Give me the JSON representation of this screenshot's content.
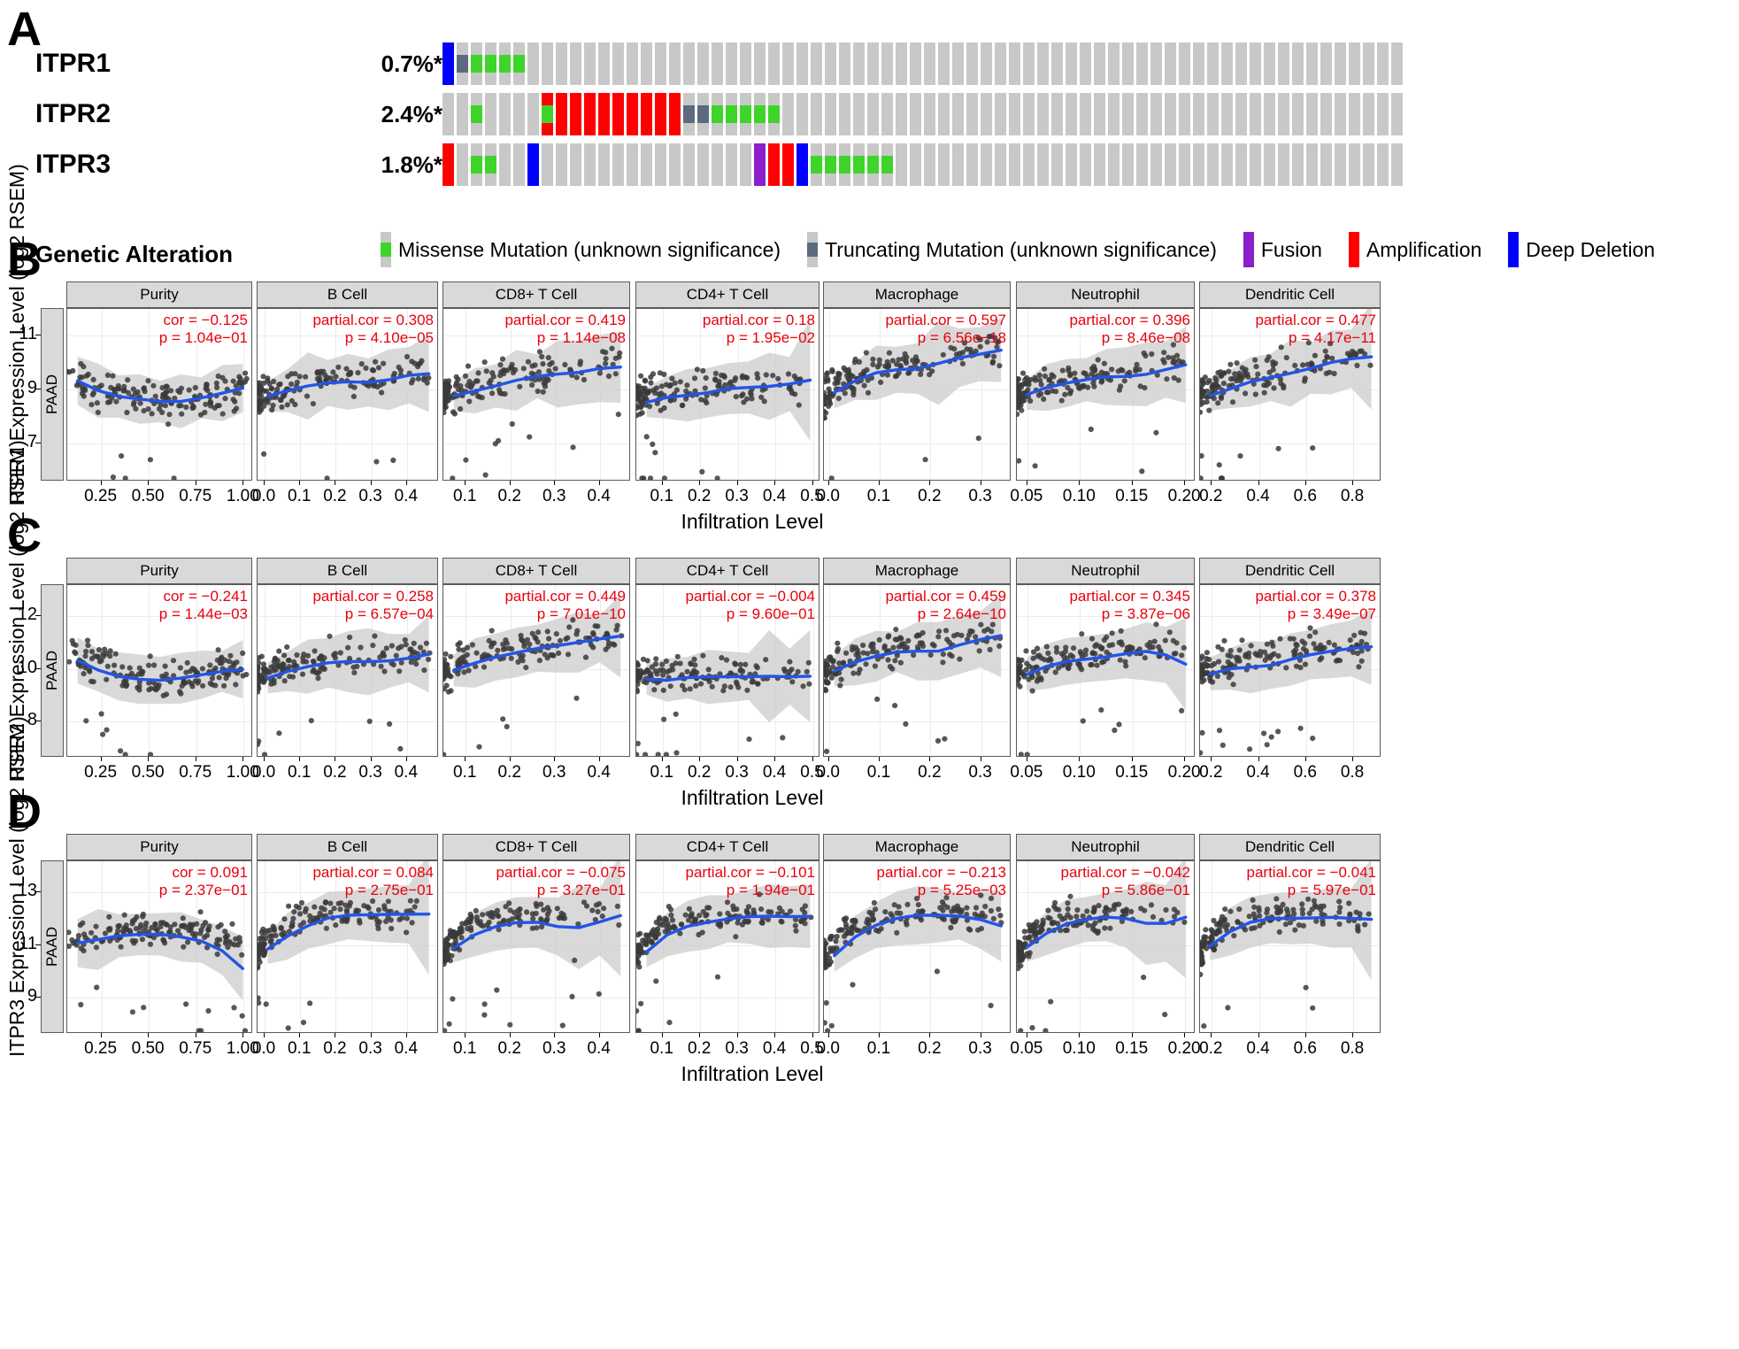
{
  "panels": {
    "a_letter": "A",
    "b_letter": "B",
    "c_letter": "C",
    "d_letter": "D"
  },
  "oncoprint": {
    "rows": [
      {
        "gene": "ITPR1",
        "percent": "0.7%*"
      },
      {
        "gene": "ITPR2",
        "percent": "2.4%*"
      },
      {
        "gene": "ITPR3",
        "percent": "1.8%*"
      }
    ],
    "legend_title": "Genetic Alteration",
    "legend": [
      {
        "label": "Missense Mutation (unknown significance)",
        "color": "#3fd42a",
        "style": "inner"
      },
      {
        "label": "Truncating Mutation (unknown significance)",
        "color": "#5b6b7d",
        "style": "inner"
      },
      {
        "label": "Fusion",
        "color": "#8b1fc9",
        "style": "full"
      },
      {
        "label": "Amplification",
        "color": "#ff0000",
        "style": "full"
      },
      {
        "label": "Deep Deletion",
        "color": "#0000ff",
        "style": "full"
      }
    ],
    "colors": {
      "background": "#c8c8c8",
      "missense": "#3fd42a",
      "truncating": "#5b6b7d",
      "fusion": "#8b1fc9",
      "amplification": "#ff0000",
      "deep_deletion": "#0000ff"
    },
    "n_columns": 68,
    "tracks": {
      "ITPR1": [
        {
          "i": 0,
          "type": "deep_deletion"
        },
        {
          "i": 1,
          "type": "truncating"
        },
        {
          "i": 2,
          "type": "missense"
        },
        {
          "i": 3,
          "type": "missense"
        },
        {
          "i": 4,
          "type": "missense"
        },
        {
          "i": 5,
          "type": "missense"
        }
      ],
      "ITPR2": [
        {
          "i": 2,
          "type": "missense"
        },
        {
          "i": 7,
          "type": "amplification"
        },
        {
          "i": 7,
          "type": "missense"
        },
        {
          "i": 8,
          "type": "amplification"
        },
        {
          "i": 9,
          "type": "amplification"
        },
        {
          "i": 10,
          "type": "amplification"
        },
        {
          "i": 11,
          "type": "amplification"
        },
        {
          "i": 12,
          "type": "amplification"
        },
        {
          "i": 13,
          "type": "amplification"
        },
        {
          "i": 14,
          "type": "amplification"
        },
        {
          "i": 15,
          "type": "amplification"
        },
        {
          "i": 16,
          "type": "amplification"
        },
        {
          "i": 17,
          "type": "truncating"
        },
        {
          "i": 18,
          "type": "truncating"
        },
        {
          "i": 19,
          "type": "missense"
        },
        {
          "i": 20,
          "type": "missense"
        },
        {
          "i": 21,
          "type": "missense"
        },
        {
          "i": 22,
          "type": "missense"
        },
        {
          "i": 23,
          "type": "missense"
        }
      ],
      "ITPR3": [
        {
          "i": 0,
          "type": "amplification"
        },
        {
          "i": 2,
          "type": "missense"
        },
        {
          "i": 3,
          "type": "missense"
        },
        {
          "i": 6,
          "type": "deep_deletion"
        },
        {
          "i": 22,
          "type": "fusion"
        },
        {
          "i": 23,
          "type": "amplification"
        },
        {
          "i": 24,
          "type": "amplification"
        },
        {
          "i": 25,
          "type": "deep_deletion"
        },
        {
          "i": 26,
          "type": "missense"
        },
        {
          "i": 27,
          "type": "missense"
        },
        {
          "i": 28,
          "type": "missense"
        },
        {
          "i": 29,
          "type": "missense"
        },
        {
          "i": 30,
          "type": "missense"
        },
        {
          "i": 31,
          "type": "missense"
        }
      ]
    }
  },
  "chart_data": [
    {
      "id": "B",
      "type": "scatter",
      "title": "ITPR1 Expression Level (log2 RSEM)",
      "ylabel": "ITPR1 Expression Level (log2 RSEM)",
      "xlabel": "Infiltration Level",
      "row_strip": "PAAD",
      "yticks": [
        7,
        9,
        11
      ],
      "ylim": [
        5.6,
        12.0
      ],
      "grid": true,
      "legend": "none",
      "smooth_color": "#2255e8",
      "point_color": "#3a3a3a",
      "ci_color": "#cccccc",
      "facets": [
        {
          "label": "Purity",
          "stat1": "cor = −0.125",
          "stat2": "p = 1.04e−01",
          "xticks": [
            "0.25",
            "0.50",
            "0.75",
            "1.00"
          ],
          "xlim": [
            0.07,
            1.05
          ]
        },
        {
          "label": "B Cell",
          "stat1": "partial.cor = 0.308",
          "stat2": "p = 4.10e−05",
          "xticks": [
            "0.0",
            "0.1",
            "0.2",
            "0.3",
            "0.4"
          ],
          "xlim": [
            -0.02,
            0.49
          ]
        },
        {
          "label": "CD8+ T Cell",
          "stat1": "partial.cor = 0.419",
          "stat2": "p = 1.14e−08",
          "xticks": [
            "0.1",
            "0.2",
            "0.3",
            "0.4"
          ],
          "xlim": [
            0.05,
            0.47
          ]
        },
        {
          "label": "CD4+ T Cell",
          "stat1": "partial.cor = 0.18",
          "stat2": "p = 1.95e−02",
          "xticks": [
            "0.1",
            "0.2",
            "0.3",
            "0.4",
            "0.5"
          ],
          "xlim": [
            0.03,
            0.52
          ]
        },
        {
          "label": "Macrophage",
          "stat1": "partial.cor = 0.597",
          "stat2": "p = 6.56e−18",
          "xticks": [
            "0.0",
            "0.1",
            "0.2",
            "0.3"
          ],
          "xlim": [
            -0.01,
            0.36
          ]
        },
        {
          "label": "Neutrophil",
          "stat1": "partial.cor = 0.396",
          "stat2": "p = 8.46e−08",
          "xticks": [
            "0.05",
            "0.10",
            "0.15",
            "0.20"
          ],
          "xlim": [
            0.04,
            0.21
          ]
        },
        {
          "label": "Dendritic Cell",
          "stat1": "partial.cor = 0.477",
          "stat2": "p = 4.17e−11",
          "xticks": [
            "0.2",
            "0.4",
            "0.6",
            "0.8"
          ],
          "xlim": [
            0.15,
            0.92
          ]
        }
      ]
    },
    {
      "id": "C",
      "type": "scatter",
      "title": "ITPR2 Expression Level (log2 RSEM)",
      "ylabel": "ITPR2 Expression Level (log2 RSEM)",
      "xlabel": "Infiltration Level",
      "row_strip": "PAAD",
      "yticks": [
        8,
        10,
        12
      ],
      "ylim": [
        6.6,
        13.2
      ],
      "grid": true,
      "legend": "none",
      "smooth_color": "#2255e8",
      "point_color": "#3a3a3a",
      "ci_color": "#cccccc",
      "facets": [
        {
          "label": "Purity",
          "stat1": "cor = −0.241",
          "stat2": "p = 1.44e−03",
          "xticks": [
            "0.25",
            "0.50",
            "0.75",
            "1.00"
          ],
          "xlim": [
            0.07,
            1.05
          ]
        },
        {
          "label": "B Cell",
          "stat1": "partial.cor = 0.258",
          "stat2": "p = 6.57e−04",
          "xticks": [
            "0.0",
            "0.1",
            "0.2",
            "0.3",
            "0.4"
          ],
          "xlim": [
            -0.02,
            0.49
          ]
        },
        {
          "label": "CD8+ T Cell",
          "stat1": "partial.cor = 0.449",
          "stat2": "p = 7.01e−10",
          "xticks": [
            "0.1",
            "0.2",
            "0.3",
            "0.4"
          ],
          "xlim": [
            0.05,
            0.47
          ]
        },
        {
          "label": "CD4+ T Cell",
          "stat1": "partial.cor = −0.004",
          "stat2": "p = 9.60e−01",
          "xticks": [
            "0.1",
            "0.2",
            "0.3",
            "0.4",
            "0.5"
          ],
          "xlim": [
            0.03,
            0.52
          ]
        },
        {
          "label": "Macrophage",
          "stat1": "partial.cor = 0.459",
          "stat2": "p = 2.64e−10",
          "xticks": [
            "0.0",
            "0.1",
            "0.2",
            "0.3"
          ],
          "xlim": [
            -0.01,
            0.36
          ]
        },
        {
          "label": "Neutrophil",
          "stat1": "partial.cor = 0.345",
          "stat2": "p = 3.87e−06",
          "xticks": [
            "0.05",
            "0.10",
            "0.15",
            "0.20"
          ],
          "xlim": [
            0.04,
            0.21
          ]
        },
        {
          "label": "Dendritic Cell",
          "stat1": "partial.cor = 0.378",
          "stat2": "p = 3.49e−07",
          "xticks": [
            "0.2",
            "0.4",
            "0.6",
            "0.8"
          ],
          "xlim": [
            0.15,
            0.92
          ]
        }
      ]
    },
    {
      "id": "D",
      "type": "scatter",
      "title": "ITPR3 Expression Level (log2 RSEM)",
      "ylabel": "ITPR3 Expression Level (log2 RSEM)",
      "xlabel": "Infiltration Level",
      "row_strip": "PAAD",
      "yticks": [
        9,
        11,
        13
      ],
      "ylim": [
        7.6,
        14.2
      ],
      "grid": true,
      "legend": "none",
      "smooth_color": "#2255e8",
      "point_color": "#3a3a3a",
      "ci_color": "#cccccc",
      "facets": [
        {
          "label": "Purity",
          "stat1": "cor = 0.091",
          "stat2": "p = 2.37e−01",
          "xticks": [
            "0.25",
            "0.50",
            "0.75",
            "1.00"
          ],
          "xlim": [
            0.07,
            1.05
          ]
        },
        {
          "label": "B Cell",
          "stat1": "partial.cor = 0.084",
          "stat2": "p = 2.75e−01",
          "xticks": [
            "0.0",
            "0.1",
            "0.2",
            "0.3",
            "0.4"
          ],
          "xlim": [
            -0.02,
            0.49
          ]
        },
        {
          "label": "CD8+ T Cell",
          "stat1": "partial.cor = −0.075",
          "stat2": "p = 3.27e−01",
          "xticks": [
            "0.1",
            "0.2",
            "0.3",
            "0.4"
          ],
          "xlim": [
            0.05,
            0.47
          ]
        },
        {
          "label": "CD4+ T Cell",
          "stat1": "partial.cor = −0.101",
          "stat2": "p = 1.94e−01",
          "xticks": [
            "0.1",
            "0.2",
            "0.3",
            "0.4",
            "0.5"
          ],
          "xlim": [
            0.03,
            0.52
          ]
        },
        {
          "label": "Macrophage",
          "stat1": "partial.cor = −0.213",
          "stat2": "p = 5.25e−03",
          "xticks": [
            "0.0",
            "0.1",
            "0.2",
            "0.3"
          ],
          "xlim": [
            -0.01,
            0.36
          ]
        },
        {
          "label": "Neutrophil",
          "stat1": "partial.cor = −0.042",
          "stat2": "p = 5.86e−01",
          "xticks": [
            "0.05",
            "0.10",
            "0.15",
            "0.20"
          ],
          "xlim": [
            0.04,
            0.21
          ]
        },
        {
          "label": "Dendritic Cell",
          "stat1": "partial.cor = −0.041",
          "stat2": "p = 5.97e−01",
          "xticks": [
            "0.2",
            "0.4",
            "0.6",
            "0.8"
          ],
          "xlim": [
            0.15,
            0.92
          ]
        }
      ]
    }
  ]
}
